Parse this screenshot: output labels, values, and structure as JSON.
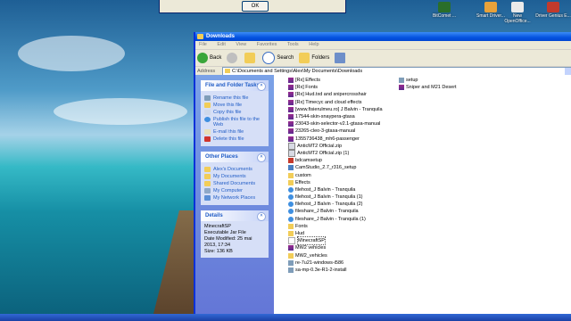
{
  "dialog": {
    "ok_label": "OK"
  },
  "desktop_icons": [
    {
      "label": "BitComet ..."
    },
    {
      "label": "Smart Driver..."
    },
    {
      "label": "New OpenOffice..."
    },
    {
      "label": "Driver Genius E..."
    }
  ],
  "window": {
    "title": "Downloads",
    "menu": [
      "File",
      "Edit",
      "View",
      "Favorites",
      "Tools",
      "Help"
    ],
    "toolbar": {
      "back": "Back",
      "search": "Search",
      "folders": "Folders"
    },
    "address_label": "Address",
    "address_path": "C:\\Documents and Settings\\Alex\\My Documents\\Downloads"
  },
  "tasks": {
    "file_folder": {
      "title": "File and Folder Tasks",
      "items": [
        "Rename this file",
        "Move this file",
        "Copy this file",
        "Publish this file to the Web",
        "E-mail this file",
        "Delete this file"
      ]
    },
    "other_places": {
      "title": "Other Places",
      "items": [
        "Alex's Documents",
        "My Documents",
        "Shared Documents",
        "My Computer",
        "My Network Places"
      ]
    },
    "details": {
      "title": "Details",
      "name": "MinecraftSP",
      "type": "Executable Jar File",
      "modified": "Date Modified: 25 mai 2013, 17:34",
      "size": "Size: 136 KB"
    }
  },
  "files_col1": [
    {
      "name": "[Rx] Effects",
      "icon": "rar"
    },
    {
      "name": "[Rx] Fonts",
      "icon": "rar"
    },
    {
      "name": "[Rx] Hud.txd and snipercrosshair",
      "icon": "rar"
    },
    {
      "name": "[Rx] Timecyc and cloud effects",
      "icon": "rar"
    },
    {
      "name": "[www.fisierulmeu.ro] J Balvin - Tranquila",
      "icon": "rar"
    },
    {
      "name": "17544-skin-snaypera-gtasa",
      "icon": "rar"
    },
    {
      "name": "23043-skin-selector-v2.1-gtasa-manual",
      "icon": "rar"
    },
    {
      "name": "23265-cleo-3-gtasa-manual",
      "icon": "rar"
    },
    {
      "name": "1355736438_mh6-passenger",
      "icon": "rar"
    },
    {
      "name": "AnticMT2 Official.zip",
      "icon": "pdf"
    },
    {
      "name": "AnticMT2 Official.zip (1)",
      "icon": "pdf"
    },
    {
      "name": "bdcamsetup",
      "icon": "red"
    },
    {
      "name": "CamStudio_2.7_r316_setup",
      "icon": "app"
    },
    {
      "name": "custom",
      "icon": "fold"
    },
    {
      "name": "Effects",
      "icon": "fold"
    },
    {
      "name": "filehost_J Balvin - Tranquila",
      "icon": "ie"
    },
    {
      "name": "filehost_J Balvin - Tranquila (1)",
      "icon": "ie"
    },
    {
      "name": "filehost_J Balvin - Tranquila (2)",
      "icon": "ie"
    },
    {
      "name": "fileshare_J Balvin - Tranquila",
      "icon": "ie"
    },
    {
      "name": "fileshare_J Balvin - Tranquila (1)",
      "icon": "ie"
    },
    {
      "name": "Fonts",
      "icon": "fold"
    },
    {
      "name": "Hud",
      "icon": "fold"
    },
    {
      "name": "MinecraftSP",
      "icon": "jar"
    },
    {
      "name": "MW2 vehicles",
      "icon": "rar"
    },
    {
      "name": "MW2_vehicles",
      "icon": "fold"
    },
    {
      "name": "re-7u21-windows-i586",
      "icon": "exe"
    },
    {
      "name": "sa-mp-0.3e-R1-2-install",
      "icon": "exe"
    }
  ],
  "files_col2": [
    {
      "name": "setup",
      "icon": "exe"
    },
    {
      "name": "Sniper and M21 Desert",
      "icon": "rar"
    }
  ],
  "selected_file": "MinecraftSP"
}
